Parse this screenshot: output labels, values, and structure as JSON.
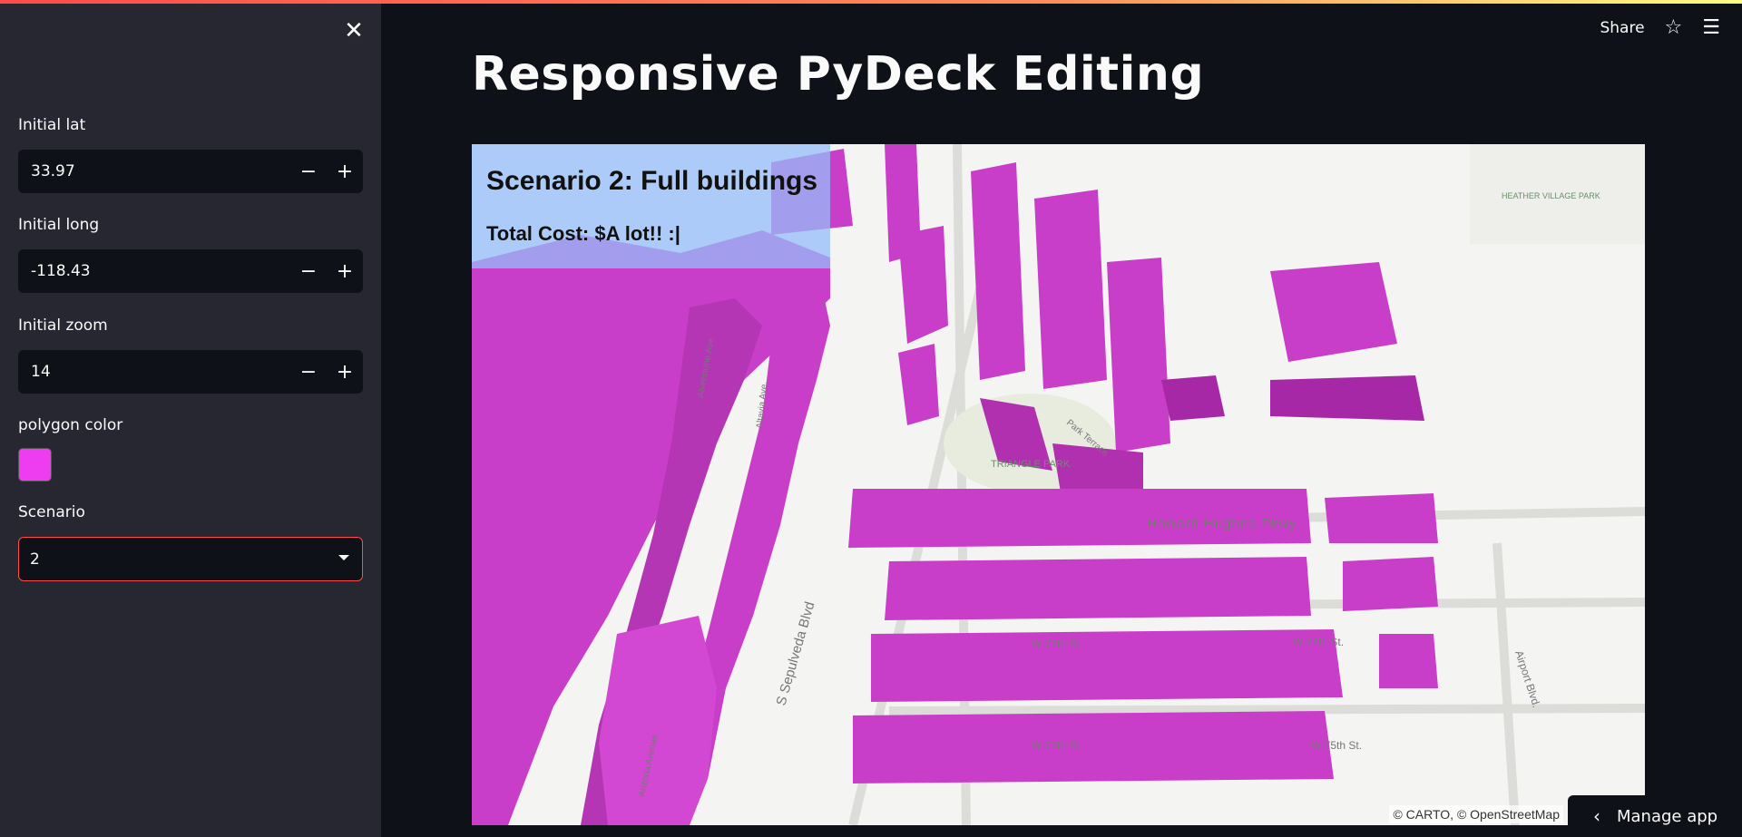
{
  "header": {
    "share_label": "Share",
    "star_icon": "star-icon",
    "menu_icon": "hamburger-menu-icon"
  },
  "sidebar": {
    "close_icon": "close-icon",
    "lat": {
      "label": "Initial lat",
      "value": "33.97"
    },
    "long": {
      "label": "Initial long",
      "value": "-118.43"
    },
    "zoom": {
      "label": "Initial zoom",
      "value": "14"
    },
    "color": {
      "label": "polygon color",
      "value": "#ee3cf0"
    },
    "scenario": {
      "label": "Scenario",
      "value": "2"
    },
    "minus": "−",
    "plus": "+"
  },
  "main": {
    "title": "Responsive PyDeck Editing",
    "map": {
      "overlay_title": "Scenario 2: Full buildings",
      "overlay_cost": "Total Cost: $A lot!! :|",
      "street_labels": [
        "Howard Hughes Pkwy",
        "S Sepulveda Blvd",
        "W 74th St.",
        "W 75th St.",
        "Airport Blvd.",
        "TRIANGLE PARK",
        "HEATHER VILLAGE PARK",
        "Park Terrace",
        "Arizona Avenue",
        "Altavia Ave.",
        "Alverstone Ave."
      ],
      "attribution": "© CARTO, © OpenStreetMap",
      "building_color": "#c93ec8"
    }
  },
  "footer": {
    "manage_label": "Manage app"
  }
}
